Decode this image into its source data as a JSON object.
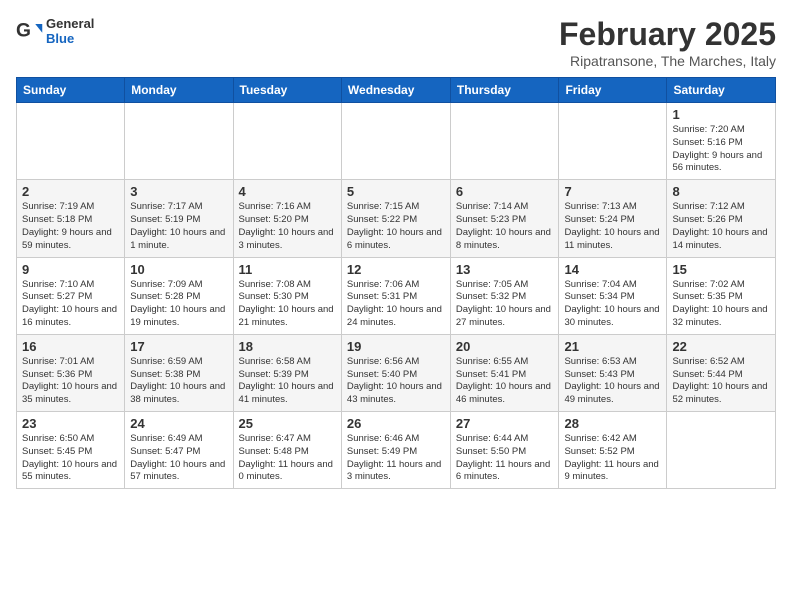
{
  "header": {
    "logo_general": "General",
    "logo_blue": "Blue",
    "title": "February 2025",
    "subtitle": "Ripatransone, The Marches, Italy"
  },
  "columns": [
    "Sunday",
    "Monday",
    "Tuesday",
    "Wednesday",
    "Thursday",
    "Friday",
    "Saturday"
  ],
  "weeks": [
    [
      {
        "day": "",
        "info": ""
      },
      {
        "day": "",
        "info": ""
      },
      {
        "day": "",
        "info": ""
      },
      {
        "day": "",
        "info": ""
      },
      {
        "day": "",
        "info": ""
      },
      {
        "day": "",
        "info": ""
      },
      {
        "day": "1",
        "info": "Sunrise: 7:20 AM\nSunset: 5:16 PM\nDaylight: 9 hours and 56 minutes."
      }
    ],
    [
      {
        "day": "2",
        "info": "Sunrise: 7:19 AM\nSunset: 5:18 PM\nDaylight: 9 hours and 59 minutes."
      },
      {
        "day": "3",
        "info": "Sunrise: 7:17 AM\nSunset: 5:19 PM\nDaylight: 10 hours and 1 minute."
      },
      {
        "day": "4",
        "info": "Sunrise: 7:16 AM\nSunset: 5:20 PM\nDaylight: 10 hours and 3 minutes."
      },
      {
        "day": "5",
        "info": "Sunrise: 7:15 AM\nSunset: 5:22 PM\nDaylight: 10 hours and 6 minutes."
      },
      {
        "day": "6",
        "info": "Sunrise: 7:14 AM\nSunset: 5:23 PM\nDaylight: 10 hours and 8 minutes."
      },
      {
        "day": "7",
        "info": "Sunrise: 7:13 AM\nSunset: 5:24 PM\nDaylight: 10 hours and 11 minutes."
      },
      {
        "day": "8",
        "info": "Sunrise: 7:12 AM\nSunset: 5:26 PM\nDaylight: 10 hours and 14 minutes."
      }
    ],
    [
      {
        "day": "9",
        "info": "Sunrise: 7:10 AM\nSunset: 5:27 PM\nDaylight: 10 hours and 16 minutes."
      },
      {
        "day": "10",
        "info": "Sunrise: 7:09 AM\nSunset: 5:28 PM\nDaylight: 10 hours and 19 minutes."
      },
      {
        "day": "11",
        "info": "Sunrise: 7:08 AM\nSunset: 5:30 PM\nDaylight: 10 hours and 21 minutes."
      },
      {
        "day": "12",
        "info": "Sunrise: 7:06 AM\nSunset: 5:31 PM\nDaylight: 10 hours and 24 minutes."
      },
      {
        "day": "13",
        "info": "Sunrise: 7:05 AM\nSunset: 5:32 PM\nDaylight: 10 hours and 27 minutes."
      },
      {
        "day": "14",
        "info": "Sunrise: 7:04 AM\nSunset: 5:34 PM\nDaylight: 10 hours and 30 minutes."
      },
      {
        "day": "15",
        "info": "Sunrise: 7:02 AM\nSunset: 5:35 PM\nDaylight: 10 hours and 32 minutes."
      }
    ],
    [
      {
        "day": "16",
        "info": "Sunrise: 7:01 AM\nSunset: 5:36 PM\nDaylight: 10 hours and 35 minutes."
      },
      {
        "day": "17",
        "info": "Sunrise: 6:59 AM\nSunset: 5:38 PM\nDaylight: 10 hours and 38 minutes."
      },
      {
        "day": "18",
        "info": "Sunrise: 6:58 AM\nSunset: 5:39 PM\nDaylight: 10 hours and 41 minutes."
      },
      {
        "day": "19",
        "info": "Sunrise: 6:56 AM\nSunset: 5:40 PM\nDaylight: 10 hours and 43 minutes."
      },
      {
        "day": "20",
        "info": "Sunrise: 6:55 AM\nSunset: 5:41 PM\nDaylight: 10 hours and 46 minutes."
      },
      {
        "day": "21",
        "info": "Sunrise: 6:53 AM\nSunset: 5:43 PM\nDaylight: 10 hours and 49 minutes."
      },
      {
        "day": "22",
        "info": "Sunrise: 6:52 AM\nSunset: 5:44 PM\nDaylight: 10 hours and 52 minutes."
      }
    ],
    [
      {
        "day": "23",
        "info": "Sunrise: 6:50 AM\nSunset: 5:45 PM\nDaylight: 10 hours and 55 minutes."
      },
      {
        "day": "24",
        "info": "Sunrise: 6:49 AM\nSunset: 5:47 PM\nDaylight: 10 hours and 57 minutes."
      },
      {
        "day": "25",
        "info": "Sunrise: 6:47 AM\nSunset: 5:48 PM\nDaylight: 11 hours and 0 minutes."
      },
      {
        "day": "26",
        "info": "Sunrise: 6:46 AM\nSunset: 5:49 PM\nDaylight: 11 hours and 3 minutes."
      },
      {
        "day": "27",
        "info": "Sunrise: 6:44 AM\nSunset: 5:50 PM\nDaylight: 11 hours and 6 minutes."
      },
      {
        "day": "28",
        "info": "Sunrise: 6:42 AM\nSunset: 5:52 PM\nDaylight: 11 hours and 9 minutes."
      },
      {
        "day": "",
        "info": ""
      }
    ]
  ]
}
